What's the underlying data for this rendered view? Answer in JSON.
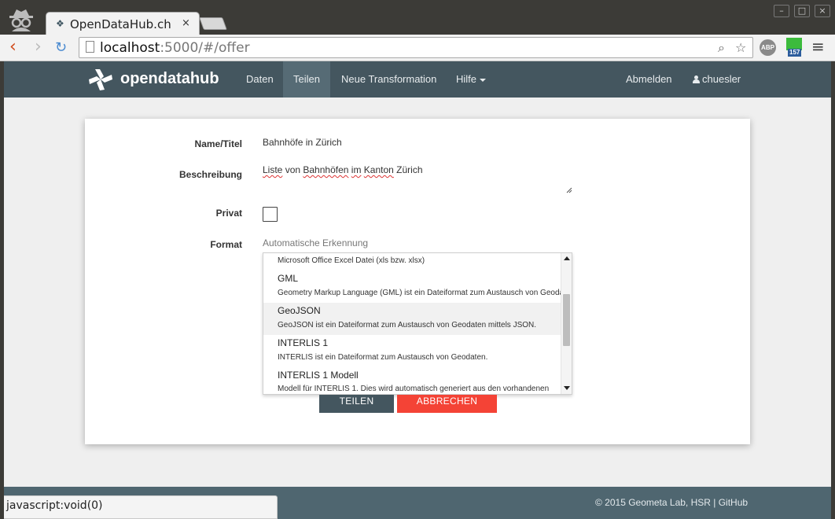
{
  "browser": {
    "tab_title": "OpenDataHub.ch",
    "tab_favicon": "❖",
    "tab_close": "×",
    "url_host": "localhost",
    "url_rest": ":5000/#/offer",
    "abp_label": "ABP",
    "extension_badge": "157",
    "status_url": "javascript:void(0)"
  },
  "nav": {
    "brand": "opendatahub",
    "items": [
      {
        "label": "Daten"
      },
      {
        "label": "Teilen"
      },
      {
        "label": "Neue Transformation"
      },
      {
        "label": "Hilfe"
      }
    ],
    "logout": "Abmelden",
    "user": "chuesler"
  },
  "form": {
    "name_label": "Name/Titel",
    "name_value": "Bahnhöfe in Zürich",
    "description_label": "Beschreibung",
    "description_words": [
      "Liste",
      " von ",
      "Bahnhöfen",
      " ",
      "im",
      " ",
      "Kanton",
      " Zürich"
    ],
    "private_label": "Privat",
    "private_checked": false,
    "format_label": "Format",
    "format_value": "Automatische Erkennung",
    "format_options": [
      {
        "title": "",
        "description": "Microsoft Office Excel Datei (xls bzw. xlsx)"
      },
      {
        "title": "GML",
        "description": "Geometry Markup Language (GML) ist ein Dateiformat zum Austausch von Geodaten."
      },
      {
        "title": "GeoJSON",
        "description": "GeoJSON ist ein Dateiformat zum Austausch von Geodaten mittels JSON."
      },
      {
        "title": "INTERLIS 1",
        "description": "INTERLIS ist ein Dateiformat zum Austausch von Geodaten."
      },
      {
        "title": "INTERLIS 1 Modell",
        "description": "Modell für INTERLIS 1. Dies wird automatisch generiert aus den vorhandenen"
      }
    ],
    "share_button": "TEILEN",
    "cancel_button": "ABBRECHEN"
  },
  "footer": {
    "text": "© 2015 Geometa Lab, HSR | GitHub"
  },
  "colors": {
    "navbar": "#44565f",
    "active_nav": "#566b75",
    "cancel": "#f44336",
    "footer": "#4f6670"
  }
}
